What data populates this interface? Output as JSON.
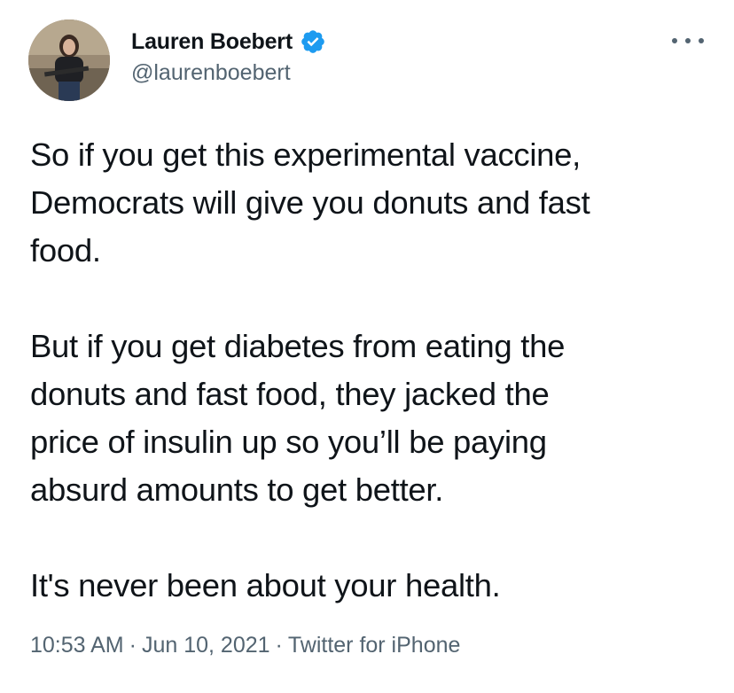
{
  "tweet": {
    "author": {
      "display_name": "Lauren Boebert",
      "handle": "@laurenboebert",
      "verified": true,
      "avatar_icon": "profile-photo"
    },
    "more_icon": "more-horizontal-icon",
    "body": {
      "line1": "So if you get this experimental vaccine,",
      "line2": "Democrats will give you donuts and fast",
      "line3": "food.",
      "line4": "But if you get diabetes from eating the",
      "line5": "donuts and fast food, they jacked the",
      "line6": "price of insulin up so you’ll be paying",
      "line7": "absurd amounts to get better.",
      "line8": "It's never been about your health."
    },
    "meta": {
      "time": "10:53 AM",
      "date": "Jun 10, 2021",
      "source": "Twitter for iPhone",
      "separator": "·"
    },
    "colors": {
      "text": "#0f1419",
      "secondary": "#536471",
      "verified_badge": "#1d9bf0"
    }
  }
}
